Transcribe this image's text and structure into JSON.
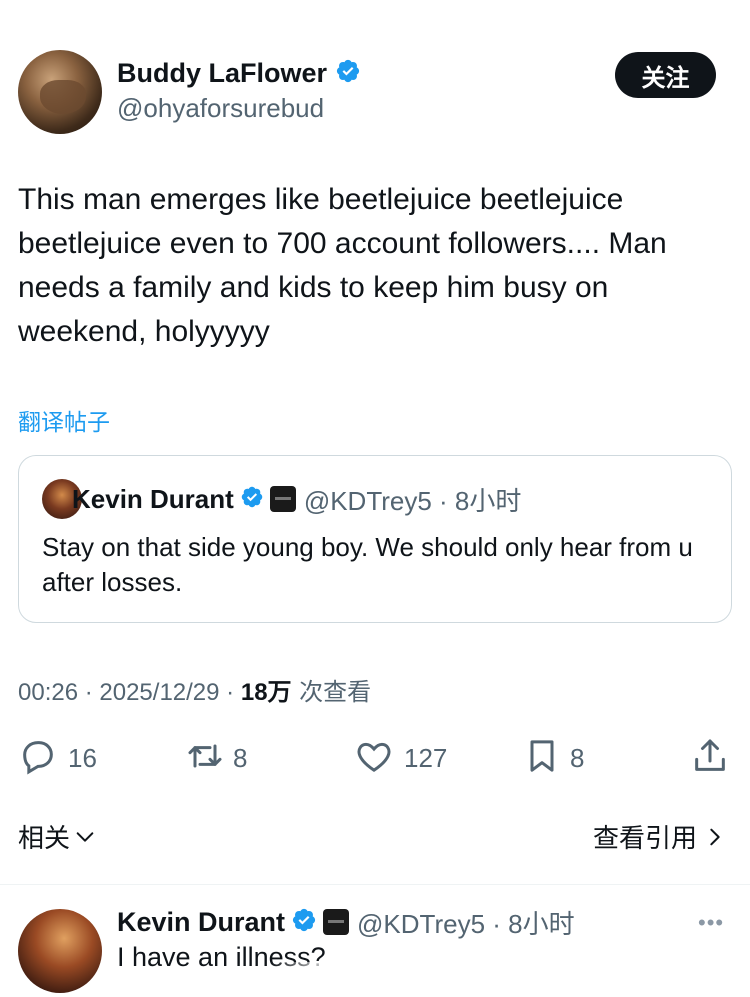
{
  "author": {
    "display_name": "Buddy LaFlower",
    "handle": "@ohyaforsurebud",
    "verified": true
  },
  "follow_button_label": "关注",
  "tweet": {
    "text": "This man emerges like beetlejuice beetlejuice beetlejuice even to 700 account followers.... Man needs a family and kids to keep him busy on weekend, holyyyyy",
    "translate_label": "翻译帖子"
  },
  "quoted_tweet": {
    "display_name": "Kevin Durant",
    "handle_time": "@KDTrey5 · 8小时",
    "text": "Stay on that side young boy. We should only hear from u after losses."
  },
  "meta": {
    "time_date": "00:26 · 2025/12/29 · ",
    "views_count": "18万",
    "views_label": " 次查看"
  },
  "actions": {
    "replies": "16",
    "reposts": "8",
    "likes": "127",
    "bookmarks": "8"
  },
  "related_label": "相关",
  "view_quotes_label": "查看引用",
  "reply": {
    "display_name": "Kevin Durant",
    "handle_time": "@KDTrey5 · 8小时",
    "text": "I have an illness?",
    "more_label": "•••"
  },
  "colors": {
    "verified_blue": "#1d9bf0",
    "link_blue": "#1d9bf0",
    "secondary_text": "#536471",
    "primary_text": "#0f1419"
  }
}
